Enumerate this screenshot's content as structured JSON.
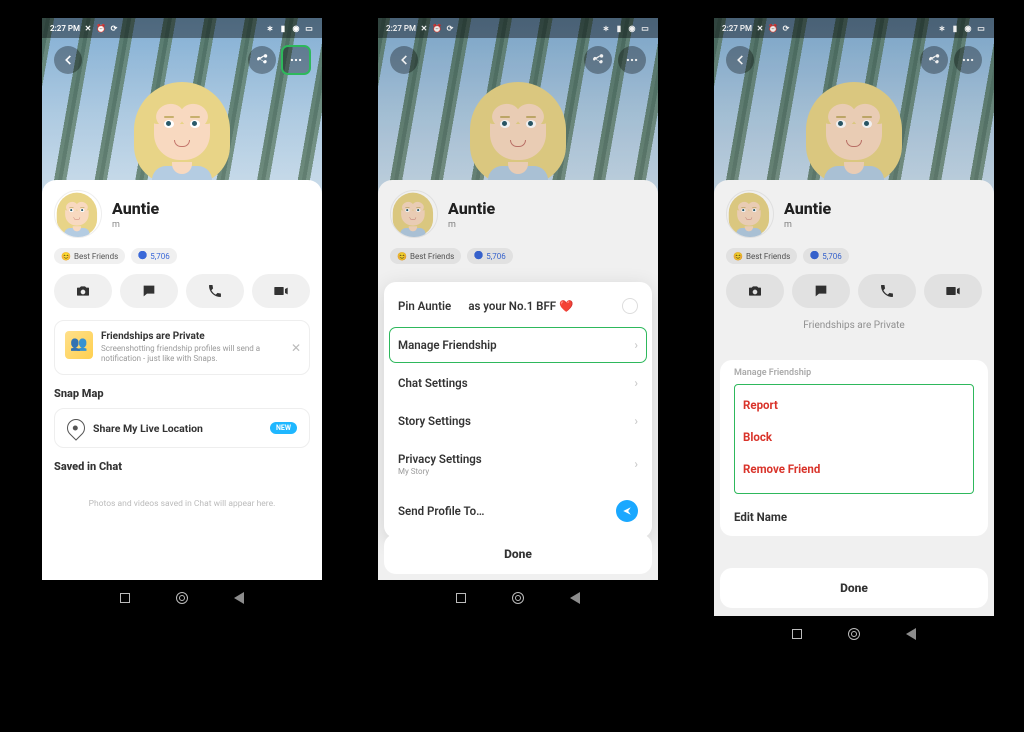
{
  "status": {
    "time": "2:27 PM"
  },
  "profile": {
    "name": "Auntie",
    "username": "m"
  },
  "badges": {
    "bestfriends_emoji": "😊",
    "bestfriends_label": "Best Friends",
    "snapscore": "5,706"
  },
  "privacy_card": {
    "title": "Friendships are Private",
    "desc": "Screenshotting friendship profiles will send a notification - just like with Snaps."
  },
  "sections": {
    "snapmap": "Snap Map",
    "share_live": "Share My Live Location",
    "new_pill": "NEW",
    "saved": "Saved in Chat",
    "saved_empty": "Photos and videos saved in Chat will appear here."
  },
  "settings_sheet": {
    "pin_pre": "Pin Auntie",
    "pin_post": "as your No.1 BFF ❤️",
    "manage": "Manage Friendship",
    "chat": "Chat Settings",
    "story": "Story Settings",
    "privacy": "Privacy Settings",
    "privacy_sub": "My Story",
    "send_to": "Send Profile To…",
    "done": "Done"
  },
  "manage_sheet": {
    "title": "Manage Friendship",
    "report": "Report",
    "block": "Block",
    "remove": "Remove Friend",
    "edit": "Edit Name",
    "done": "Done"
  }
}
